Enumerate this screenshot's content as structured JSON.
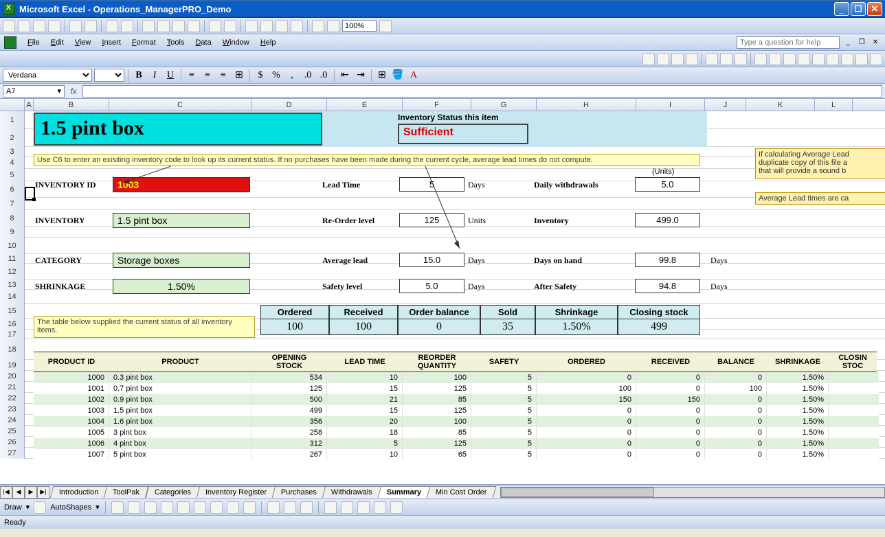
{
  "window": {
    "title": "Microsoft Excel - Operations_ManagerPRO_Demo"
  },
  "menubar": {
    "items": [
      "File",
      "Edit",
      "View",
      "Insert",
      "Format",
      "Tools",
      "Data",
      "Window",
      "Help"
    ],
    "help_placeholder": "Type a question for help"
  },
  "format_bar": {
    "font": "Verdana",
    "size": "",
    "zoom": "100%"
  },
  "formula_bar": {
    "name_box": "A7",
    "formula": ""
  },
  "column_headers": [
    "A",
    "B",
    "C",
    "D",
    "E",
    "F",
    "G",
    "H",
    "I",
    "J",
    "K",
    "L"
  ],
  "row_numbers": [
    1,
    2,
    3,
    4,
    5,
    6,
    7,
    8,
    9,
    10,
    11,
    12,
    13,
    14,
    15,
    16,
    17,
    18,
    19,
    20,
    21,
    22,
    23,
    24,
    25,
    26,
    27
  ],
  "dashboard": {
    "title": "1.5 pint box",
    "status_label": "Inventory Status this item",
    "status_value": "Sufficient",
    "instructions": "Use C6 to enter an exisiting inventory code to look up its current status. If no purchases have been made during the current cycle, average lead times do not compute.",
    "right_note1": "If calculating Average Lead\nduplicate copy of this file a\nthat will provide a sound b",
    "right_note2": "Average Lead times are ca",
    "units_label": "(Units)",
    "fields": {
      "inventory_id_label": "INVENTORY ID",
      "inventory_id": "1003",
      "inventory_label": "INVENTORY",
      "inventory": "1.5 pint box",
      "category_label": "CATEGORY",
      "category": "Storage boxes",
      "shrinkage_label": "SHRINKAGE",
      "shrinkage": "1.50%",
      "lead_time_label": "Lead Time",
      "lead_time": "5",
      "lead_time_unit": "Days",
      "reorder_label": "Re-Order level",
      "reorder": "125",
      "reorder_unit": "Units",
      "avg_lead_label": "Average lead",
      "avg_lead": "15.0",
      "avg_lead_unit": "Days",
      "safety_label": "Safety level",
      "safety": "5.0",
      "safety_unit": "Days",
      "daily_withdrawals_label": "Daily withdrawals",
      "daily_withdrawals": "5.0",
      "inventory_qty_label": "Inventory",
      "inventory_qty": "499.0",
      "days_on_hand_label": "Days on hand",
      "days_on_hand": "99.8",
      "days_on_hand_unit": "Days",
      "after_safety_label": "After Safety",
      "after_safety": "94.8",
      "after_safety_unit": "Days"
    },
    "summary": {
      "headers": [
        "Ordered",
        "Received",
        "Order balance",
        "Sold",
        "Shrinkage",
        "Closing stock"
      ],
      "values": [
        "100",
        "100",
        "0",
        "35",
        "1.50%",
        "499"
      ]
    },
    "table_note": "The table below supplied the current status of all inventory items."
  },
  "table": {
    "headers": [
      "PRODUCT ID",
      "PRODUCT",
      "OPENING STOCK",
      "LEAD TIME",
      "REORDER QUANTITY",
      "SAFETY",
      "ORDERED",
      "RECEIVED",
      "BALANCE",
      "SHRINKAGE",
      "CLOSING STOCK"
    ],
    "rows": [
      {
        "id": "1000",
        "product": "0.3 pint box",
        "open": "534",
        "lead": "10",
        "reorder": "100",
        "safety": "5",
        "ordered": "0",
        "received": "0",
        "balance": "0",
        "shrink": "1.50%"
      },
      {
        "id": "1001",
        "product": "0.7 pint box",
        "open": "125",
        "lead": "15",
        "reorder": "125",
        "safety": "5",
        "ordered": "100",
        "received": "0",
        "balance": "100",
        "shrink": "1.50%"
      },
      {
        "id": "1002",
        "product": "0.9 pint box",
        "open": "500",
        "lead": "21",
        "reorder": "85",
        "safety": "5",
        "ordered": "150",
        "received": "150",
        "balance": "0",
        "shrink": "1.50%"
      },
      {
        "id": "1003",
        "product": "1.5 pint box",
        "open": "499",
        "lead": "15",
        "reorder": "125",
        "safety": "5",
        "ordered": "0",
        "received": "0",
        "balance": "0",
        "shrink": "1.50%"
      },
      {
        "id": "1004",
        "product": "1.6 pint box",
        "open": "356",
        "lead": "20",
        "reorder": "100",
        "safety": "5",
        "ordered": "0",
        "received": "0",
        "balance": "0",
        "shrink": "1.50%"
      },
      {
        "id": "1005",
        "product": "3 pint box",
        "open": "258",
        "lead": "18",
        "reorder": "85",
        "safety": "5",
        "ordered": "0",
        "received": "0",
        "balance": "0",
        "shrink": "1.50%"
      },
      {
        "id": "1006",
        "product": "4 pint box",
        "open": "312",
        "lead": "5",
        "reorder": "125",
        "safety": "5",
        "ordered": "0",
        "received": "0",
        "balance": "0",
        "shrink": "1.50%"
      },
      {
        "id": "1007",
        "product": "5 pint box",
        "open": "267",
        "lead": "10",
        "reorder": "65",
        "safety": "5",
        "ordered": "0",
        "received": "0",
        "balance": "0",
        "shrink": "1.50%"
      }
    ]
  },
  "sheet_tabs": {
    "tabs": [
      "Introduction",
      "ToolPak",
      "Categories",
      "Inventory Register",
      "Purchases",
      "Withdrawals",
      "Summary",
      "Min Cost Order"
    ],
    "active": 6
  },
  "draw_bar": {
    "draw": "Draw",
    "autoshapes": "AutoShapes"
  },
  "status_bar": {
    "text": "Ready"
  }
}
